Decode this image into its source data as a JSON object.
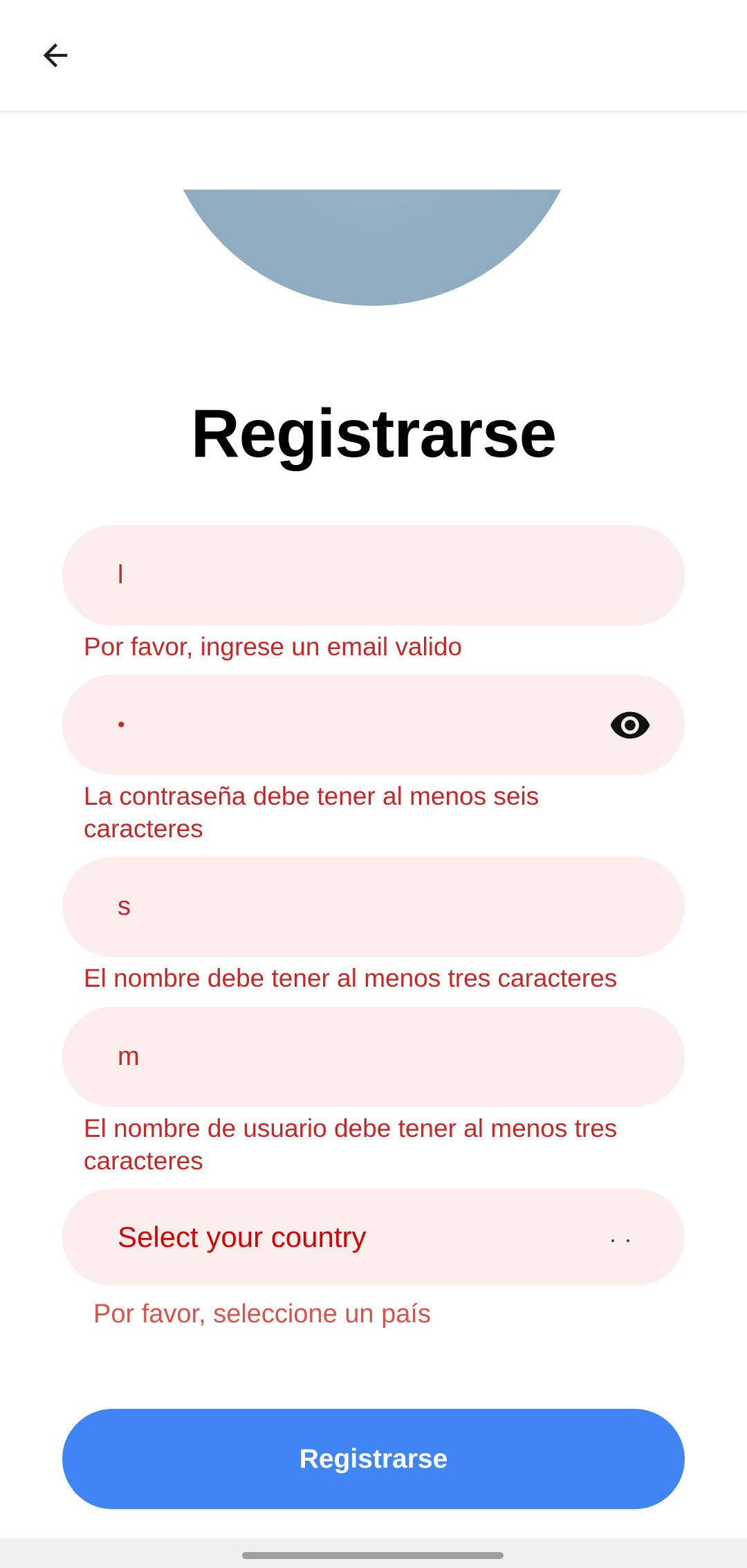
{
  "app_bar": {
    "back_icon": "arrow-left-icon"
  },
  "avatar": {
    "color": "#8fabc0"
  },
  "title": "Registrarse",
  "form": {
    "email": {
      "value": "l",
      "error": "Por favor, ingrese un email valido"
    },
    "password": {
      "value": "•",
      "toggle_icon": "eye-icon",
      "error": "La contraseña debe tener al menos seis caracteres"
    },
    "name": {
      "value": "s",
      "error": "El nombre debe tener al menos tres caracteres"
    },
    "username": {
      "value": "m",
      "error": "El nombre de usuario debe tener al menos tres caracteres"
    },
    "country": {
      "placeholder": "Select your country",
      "dropdown_icon": "chevron-down-icon",
      "error": "Por favor, seleccione un país"
    }
  },
  "submit": {
    "label": "Registrarse"
  },
  "colors": {
    "error": "#c62828",
    "field_background": "#fdeeee",
    "primary": "#3f86f4"
  }
}
